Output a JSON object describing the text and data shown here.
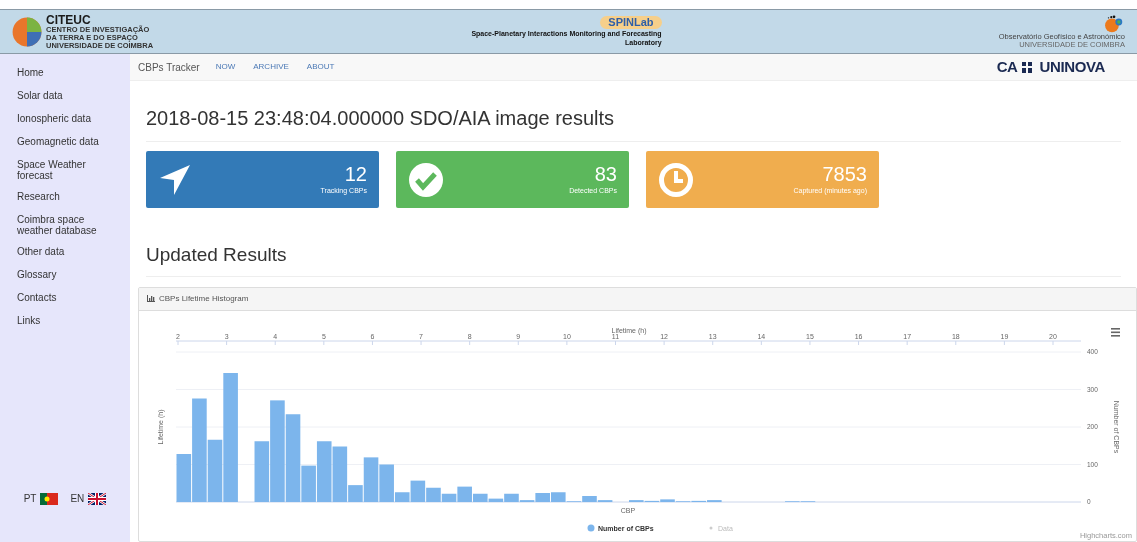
{
  "header": {
    "left_logo": {
      "name": "CITEUC",
      "lines": [
        "CENTRO DE INVESTIGAÇÃO",
        "DA TERRA E DO ESPAÇO",
        "UNIVERSIDADE DE COIMBRA"
      ]
    },
    "center_logo": {
      "name": "SPINLab",
      "caption_lines": [
        "Space-Planetary Interactions Monitoring and Forecasting",
        "Laboratory"
      ]
    },
    "right_logo": {
      "caption": "Observatório Geofísico e Astronómico",
      "subcaption": "UNIVERSIDADE DE COIMBRA"
    }
  },
  "sidebar": {
    "items": [
      {
        "label": "Home"
      },
      {
        "label": "Solar data"
      },
      {
        "label": "Ionospheric data"
      },
      {
        "label": "Geomagnetic data"
      },
      {
        "label": "Space Weather forecast"
      },
      {
        "label": "Research"
      },
      {
        "label": "Coimbra space weather database"
      },
      {
        "label": "Other data"
      },
      {
        "label": "Glossary"
      },
      {
        "label": "Contacts"
      },
      {
        "label": "Links"
      }
    ],
    "languages": [
      {
        "code": "PT",
        "kind": "pt"
      },
      {
        "code": "EN",
        "kind": "uk"
      }
    ]
  },
  "navbar": {
    "brand": "CBPs Tracker",
    "links": [
      "NOW",
      "ARCHIVE",
      "ABOUT"
    ],
    "partner": {
      "left": "CA",
      "right": "UNINOVA"
    }
  },
  "title": "2018-08-15 23:48:04.000000 SDO/AIA image results",
  "cards": [
    {
      "kind": "arrow",
      "value": "12",
      "label": "Tracking CBPs",
      "color": "#337ab7"
    },
    {
      "kind": "check",
      "value": "83",
      "label": "Detected CBPs",
      "color": "#5cb85c"
    },
    {
      "kind": "clock",
      "value": "7853",
      "label": "Captured (minutes ago)",
      "color": "#f0ad4e"
    }
  ],
  "section_title": "Updated Results",
  "chart_panel": {
    "title": "CBPs Lifetime Histogram",
    "top_axis": {
      "title": "Lifetime (h)",
      "ticks": [
        "2",
        "3",
        "4",
        "5",
        "6",
        "7",
        "8",
        "9",
        "10",
        "11",
        "12",
        "13",
        "14",
        "15",
        "16",
        "17",
        "18",
        "19",
        "20"
      ]
    },
    "left_axis_title": "Lifetime (h)",
    "legend": [
      {
        "label": "Data",
        "visible": false
      }
    ],
    "credit": "Highcharts.com",
    "chart_data": {
      "type": "bar",
      "grid": true,
      "xlabel": "CBP",
      "ylabel": "Number of CBPs",
      "ylim": [
        0,
        400
      ],
      "yticks": [
        0,
        100,
        200,
        300,
        {
          "value": 400,
          "label": "400"
        }
      ],
      "series": [
        {
          "name": "Number of CBPs",
          "color": "#7cb5ec",
          "values": [
            128,
            276,
            166,
            344,
            0,
            162,
            271,
            234,
            97,
            162,
            148,
            45,
            119,
            100,
            26,
            57,
            38,
            22,
            41,
            22,
            9,
            22,
            5,
            24,
            26,
            2,
            16,
            5,
            0,
            5,
            3,
            7,
            2,
            3,
            5,
            0,
            0,
            0,
            0,
            2,
            2,
            0,
            0,
            0,
            0,
            0,
            0,
            0,
            0,
            0,
            0,
            0,
            0,
            0,
            0,
            0,
            0,
            0
          ]
        }
      ]
    }
  }
}
